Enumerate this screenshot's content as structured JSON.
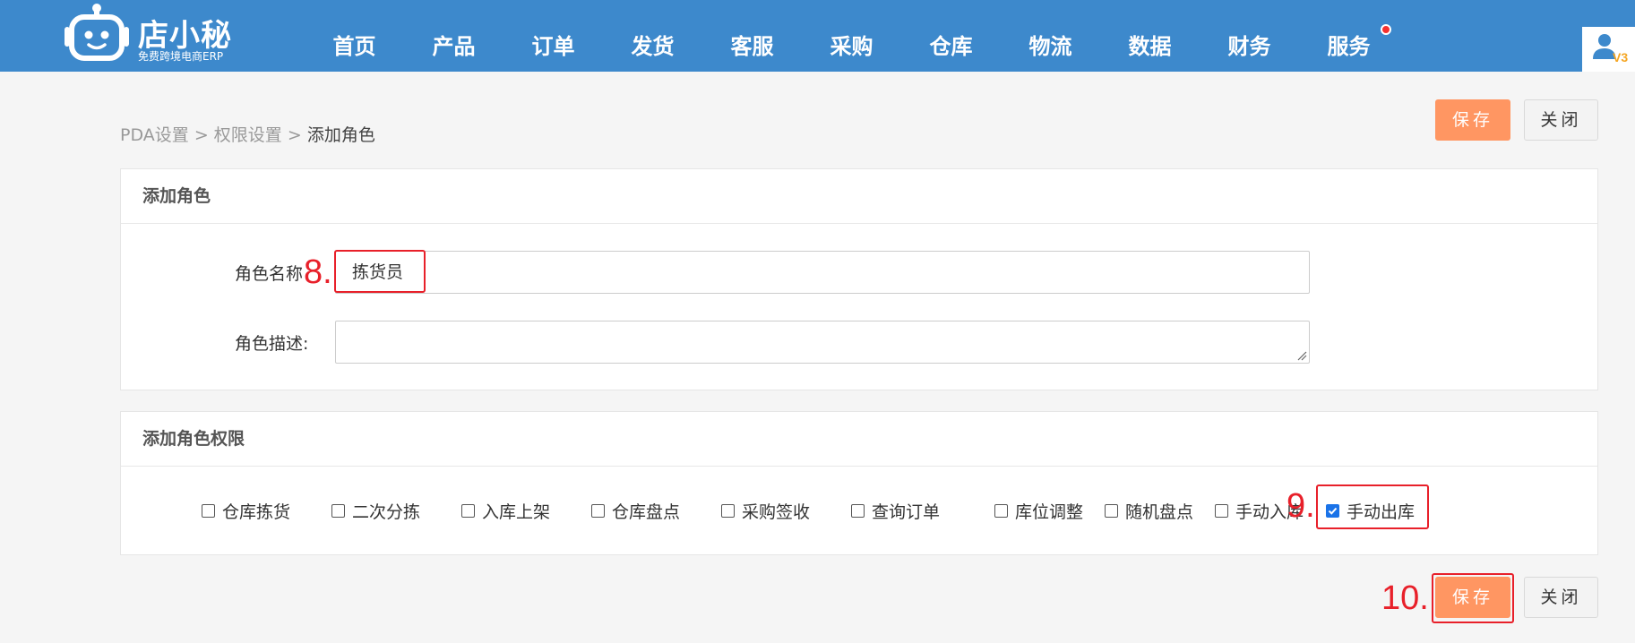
{
  "header": {
    "logo": {
      "name": "店小秘",
      "tagline": "免费跨境电商ERP"
    },
    "nav": [
      "首页",
      "产品",
      "订单",
      "发货",
      "客服",
      "采购",
      "仓库",
      "物流",
      "数据",
      "财务",
      "服务"
    ],
    "user_badge": "V3"
  },
  "breadcrumb": {
    "items": [
      "PDA设置",
      "权限设置",
      "添加角色"
    ],
    "separator": ">"
  },
  "top_actions": {
    "save": "保存",
    "close": "关闭"
  },
  "role_form": {
    "title": "添加角色",
    "name_label": "角色名称",
    "name_value": "拣货员",
    "desc_label": "角色描述:",
    "desc_value": ""
  },
  "permissions": {
    "title": "添加角色权限",
    "items": [
      {
        "label": "仓库拣货",
        "checked": false
      },
      {
        "label": "二次分拣",
        "checked": false
      },
      {
        "label": "入库上架",
        "checked": false
      },
      {
        "label": "仓库盘点",
        "checked": false
      },
      {
        "label": "采购签收",
        "checked": false
      },
      {
        "label": "查询订单",
        "checked": false
      },
      {
        "label": "库位调整",
        "checked": false
      },
      {
        "label": "随机盘点",
        "checked": false
      },
      {
        "label": "手动入库",
        "checked": false
      },
      {
        "label": "手动出库",
        "checked": true
      }
    ]
  },
  "bottom_actions": {
    "save": "保存",
    "close": "关闭"
  },
  "annotations": {
    "step8": "8.",
    "step9": "9.",
    "step10": "10."
  },
  "colors": {
    "header_bg": "#3d89cc",
    "save_button": "#ff9662",
    "annotation_red": "#e8202a",
    "notification_dot": "#f5312f",
    "checkbox_checked": "#1a73e8"
  }
}
